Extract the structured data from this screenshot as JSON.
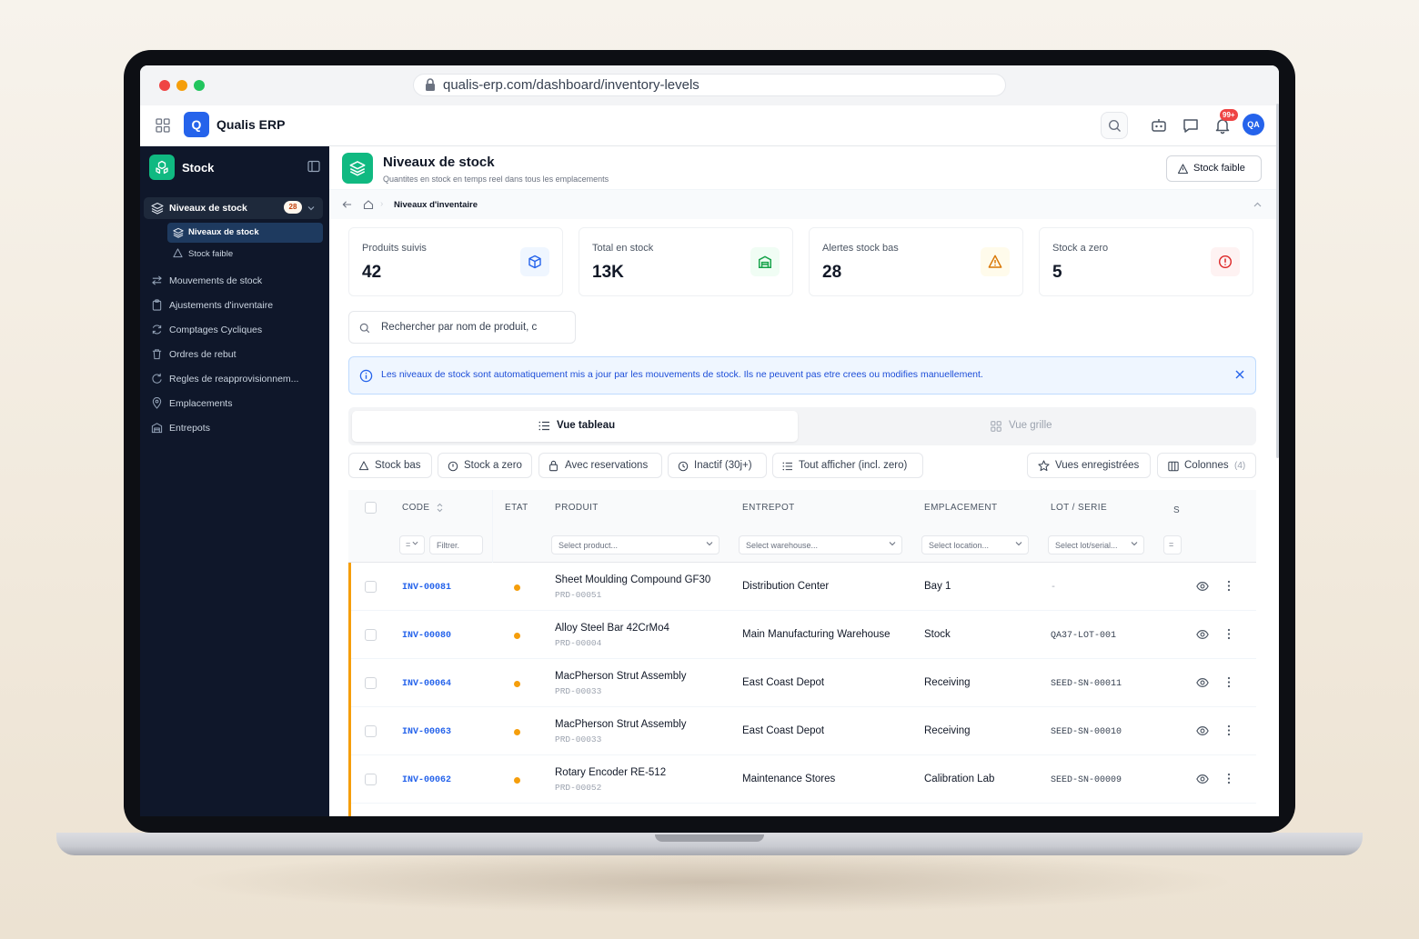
{
  "browser": {
    "url": "qualis-erp.com/dashboard/inventory-levels"
  },
  "header": {
    "app_name": "Qualis ERP",
    "logo_letter": "Q",
    "notifications": "99+",
    "avatar": "QA"
  },
  "sidebar": {
    "title": "Stock",
    "items": [
      {
        "label": "Niveaux de stock",
        "badge": "28"
      },
      {
        "label": "Niveaux de stock"
      },
      {
        "label": "Stock faible"
      },
      {
        "label": "Mouvements de stock"
      },
      {
        "label": "Ajustements d'inventaire"
      },
      {
        "label": "Comptages Cycliques"
      },
      {
        "label": "Ordres de rebut"
      },
      {
        "label": "Regles de reapprovisionnem..."
      },
      {
        "label": "Emplacements"
      },
      {
        "label": "Entrepots"
      }
    ]
  },
  "page": {
    "title": "Niveaux de stock",
    "subtitle": "Quantites en stock en temps reel dans tous les emplacements",
    "low_stock_button": "Stock faible",
    "breadcrumb": "Niveaux d'inventaire"
  },
  "kpis": [
    {
      "label": "Produits suivis",
      "value": "42",
      "color": "#2563eb"
    },
    {
      "label": "Total en stock",
      "value": "13K",
      "color": "#16a34a"
    },
    {
      "label": "Alertes stock bas",
      "value": "28",
      "color": "#d97706"
    },
    {
      "label": "Stock a zero",
      "value": "5",
      "color": "#dc2626"
    }
  ],
  "search": {
    "placeholder": "Rechercher par nom de produit, c"
  },
  "banner": {
    "text": "Les niveaux de stock sont automatiquement mis a jour par les mouvements de stock. Ils ne peuvent pas etre crees ou modifies manuellement."
  },
  "views": {
    "table": "Vue tableau",
    "grid": "Vue grille"
  },
  "filters": {
    "chips": [
      "Stock bas",
      "Stock a zero",
      "Avec reservations",
      "Inactif (30j+)",
      "Tout afficher (incl. zero)"
    ],
    "saved_views": "Vues enregistrées",
    "columns": "Colonnes",
    "columns_count": "(4)"
  },
  "table": {
    "headers": {
      "code": "CODE",
      "etat": "ETAT",
      "produit": "PRODUIT",
      "entrepot": "ENTREPOT",
      "emplacement": "EMPLACEMENT",
      "lot": "LOT / SERIE",
      "s": "S"
    },
    "filters": {
      "op": "=",
      "code": "Filtrer.",
      "product": "Select product...",
      "warehouse": "Select warehouse...",
      "location": "Select location...",
      "lot": "Select lot/serial...",
      "s": "="
    },
    "rows": [
      {
        "code": "INV-00081",
        "product": "Sheet Moulding Compound GF30",
        "product_code": "PRD-00051",
        "warehouse": "Distribution Center",
        "location": "Bay 1",
        "lot": "-"
      },
      {
        "code": "INV-00080",
        "product": "Alloy Steel Bar 42CrMo4",
        "product_code": "PRD-00004",
        "warehouse": "Main Manufacturing Warehouse",
        "location": "Stock",
        "lot": "QA37-LOT-001"
      },
      {
        "code": "INV-00064",
        "product": "MacPherson Strut Assembly",
        "product_code": "PRD-00033",
        "warehouse": "East Coast Depot",
        "location": "Receiving",
        "lot": "SEED-SN-00011"
      },
      {
        "code": "INV-00063",
        "product": "MacPherson Strut Assembly",
        "product_code": "PRD-00033",
        "warehouse": "East Coast Depot",
        "location": "Receiving",
        "lot": "SEED-SN-00010"
      },
      {
        "code": "INV-00062",
        "product": "Rotary Encoder RE-512",
        "product_code": "PRD-00052",
        "warehouse": "Maintenance Stores",
        "location": "Calibration Lab",
        "lot": "SEED-SN-00009"
      }
    ]
  },
  "colors": {
    "accent": "#2563eb",
    "sidebar": "#0f172a",
    "brand": "#10b981",
    "warning": "#f59e0b"
  }
}
